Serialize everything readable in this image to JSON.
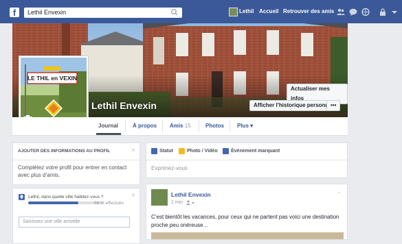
{
  "topbar": {
    "logo": "f",
    "search_value": "Lethil Envexin",
    "user_name": "Lethil",
    "home_label": "Accueil",
    "find_friends_label": "Retrouver des amis",
    "brand_color": "#3b5998",
    "icons": [
      "friend-requests-icon",
      "messages-icon",
      "globe-notifications-icon",
      "privacy-lock-icon",
      "dropdown-arrow-icon"
    ]
  },
  "cover": {
    "page_name": "Lethil Envexin",
    "update_info_label": "Actualiser mes infos",
    "view_history_label": "Afficher l’historique personnel",
    "more_label": "•••"
  },
  "profile_picture": {
    "sign_text": "LE THIL en VEXIN",
    "camera_icon": "camera-icon"
  },
  "tabs": {
    "journal": "Journal",
    "about": "À propos",
    "friends": "Amis",
    "friends_count": "15",
    "photos": "Photos",
    "more": "Plus ▾"
  },
  "add_info": {
    "title": "AJOUTER DES INFORMATIONS AU PROFIL",
    "close": "×",
    "body": "Complétez votre profil pour entrer en contact avec plus d’amis."
  },
  "city_prompt": {
    "question": "Lethil, dans quelle ville habitez-vous ?",
    "progress_label": "66 % effectués",
    "progress_fraction": 0.66,
    "close": "×",
    "input_placeholder": "Saisissez une ville actuelle"
  },
  "composer": {
    "status_label": "Statut",
    "photo_label": "Photo / Vidéo",
    "event_label": "Événement marquant",
    "placeholder": "Exprimez-vous"
  },
  "post": {
    "author": "Lethil Envexin",
    "time": "1 min",
    "text": "C’est bientôt les vacances, pour ceux qui ne partent pas voici une destination proche peu onéreuse…"
  }
}
